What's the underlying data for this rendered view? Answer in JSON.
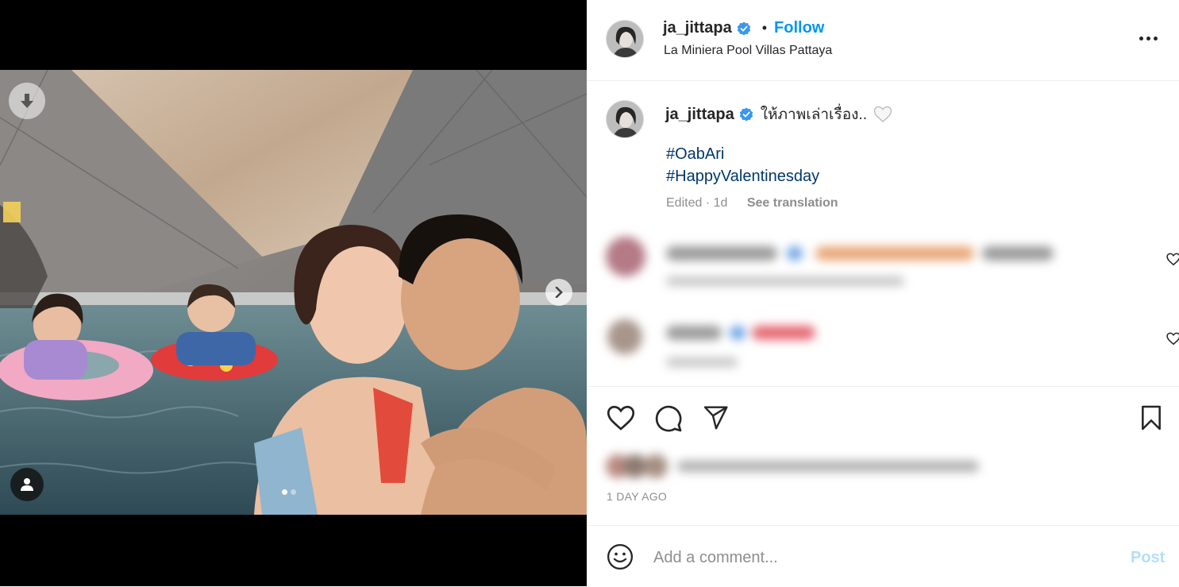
{
  "post": {
    "username": "ja_jittapa",
    "follow_label": "Follow",
    "separator": "•",
    "location": "La Miniera Pool Villas Pattaya",
    "verified_icon": "verified-badge-icon",
    "more_icon": "more-options-icon"
  },
  "caption": {
    "username": "ja_jittapa",
    "text": "ให้ภาพเล่าเรื่อง..",
    "hashtags": [
      "#OabAri",
      "#HappyValentinesday"
    ],
    "edited": "Edited · 1d",
    "see_translation": "See translation"
  },
  "carousel": {
    "total_slides": 2,
    "active_slide": 1
  },
  "comments": [
    {
      "blurred": true
    },
    {
      "blurred": true
    }
  ],
  "actions": {
    "like_icon": "heart-outline-icon",
    "comment_icon": "comment-bubble-icon",
    "share_icon": "paper-plane-icon",
    "save_icon": "bookmark-icon"
  },
  "timestamp": "1 DAY AGO",
  "composer": {
    "placeholder": "Add a comment...",
    "post_label": "Post",
    "emoji_icon": "emoji-smiley-icon"
  },
  "colors": {
    "link_blue": "#0095f6",
    "hashtag_blue": "#00376b",
    "muted_gray": "#8e8e8e",
    "post_disabled": "#b2dffc"
  }
}
